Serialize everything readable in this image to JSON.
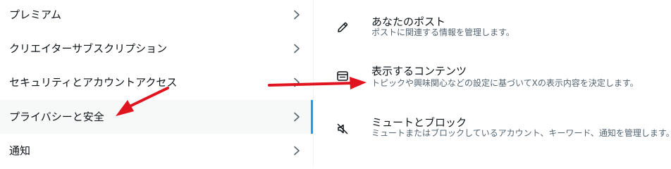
{
  "menu": {
    "items": [
      {
        "label": "プレミアム"
      },
      {
        "label": "クリエイターサブスクリプション"
      },
      {
        "label": "セキュリティとアカウントアクセス"
      },
      {
        "label": "プライバシーと安全"
      },
      {
        "label": "通知"
      }
    ],
    "selected_index": 3
  },
  "detail": {
    "items": [
      {
        "title": "あなたのポスト",
        "description": "ポストに関連する情報を管理します。",
        "icon": "pencil-icon"
      },
      {
        "title": "表示するコンテンツ",
        "description": "トピックや興味関心などの設定に基づいてXの表示内容を決定します。",
        "icon": "content-display-icon"
      },
      {
        "title": "ミュートとブロック",
        "description": "ミュートまたはブロックしているアカウント、キーワード、通知を管理します。",
        "icon": "mute-speaker-icon"
      }
    ]
  },
  "colors": {
    "accent": "#1d9bf0",
    "annotation_arrow": "#e0141e",
    "secondary_text": "#536471"
  }
}
